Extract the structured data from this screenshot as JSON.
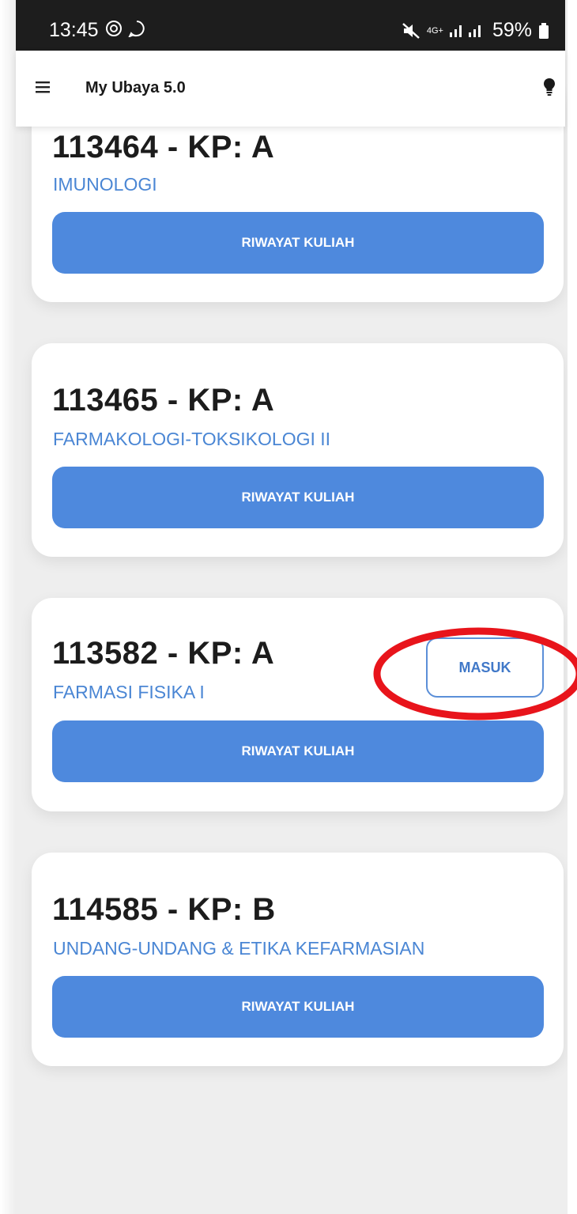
{
  "status_bar": {
    "time": "13:45",
    "network": "4G+",
    "battery": "59%"
  },
  "app_bar": {
    "title": "My Ubaya 5.0",
    "icons": [
      "menu-icon",
      "lightbulb-icon"
    ]
  },
  "courses": [
    {
      "title": "113464 - KP: A",
      "name": "IMUNOLOGI",
      "button": "RIWAYAT KULIAH"
    },
    {
      "title": "113465 - KP: A",
      "name": "FARMAKOLOGI-TOKSIKOLOGI II",
      "button": "RIWAYAT KULIAH"
    },
    {
      "title": "113582 - KP: A",
      "name": "FARMASI FISIKA I",
      "button": "RIWAYAT KULIAH",
      "masuk": "MASUK"
    },
    {
      "title": "114585 - KP: B",
      "name": "UNDANG-UNDANG & ETIKA KEFARMASIAN",
      "button": "RIWAYAT KULIAH"
    }
  ],
  "colors": {
    "accent": "#4e89dd",
    "link": "#4a86d4",
    "annotation": "#e8141b"
  }
}
